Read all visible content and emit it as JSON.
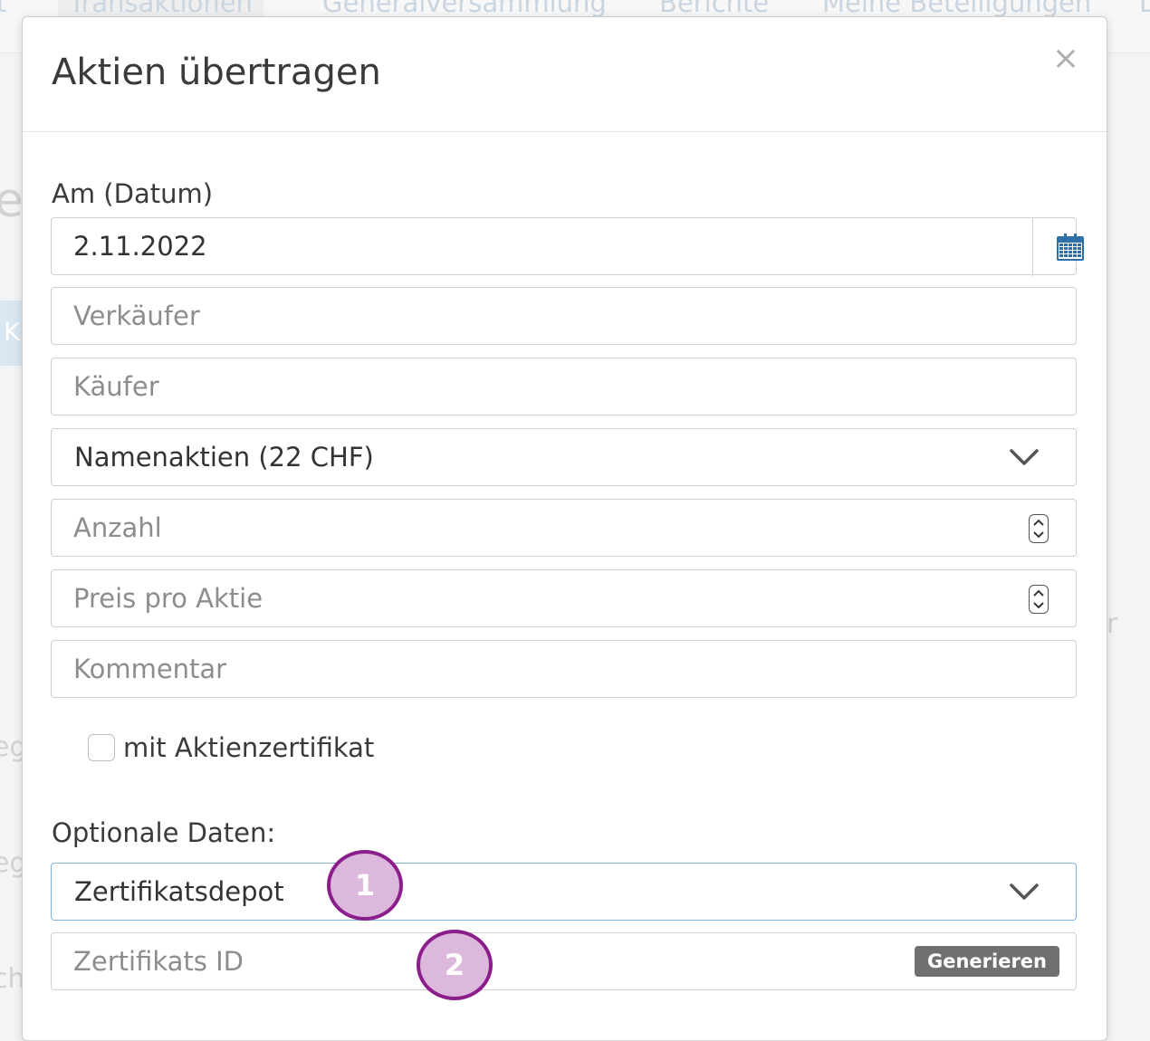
{
  "background": {
    "nav_tabs": [
      "t",
      "Transaktionen",
      "Generalversammlung",
      "Berichte",
      "Meine Beteiligungen",
      "L"
    ],
    "side_fragments": [
      "e",
      "K",
      "eg",
      "eg",
      "ch",
      "r"
    ]
  },
  "modal": {
    "title": "Aktien übertragen",
    "close": "×",
    "date_label": "Am (Datum)",
    "date_value": "2.11.2022",
    "seller_placeholder": "Verkäufer",
    "buyer_placeholder": "Käufer",
    "share_type_value": "Namenaktien (22 CHF)",
    "quantity_placeholder": "Anzahl",
    "price_placeholder": "Preis pro Aktie",
    "comment_placeholder": "Kommentar",
    "certificate_checkbox_label": "mit Aktienzertifikat",
    "optional_label": "Optionale Daten:",
    "depot_value": "Zertifikatsdepot",
    "certificate_id_placeholder": "Zertifikats ID",
    "generate_button": "Generieren"
  },
  "annotations": [
    "1",
    "2"
  ],
  "colors": {
    "calendar_icon": "#2f6fa8",
    "marker_fill": "#dcb8dc",
    "marker_border": "#8b1e8b",
    "focus_border": "#7fb2dd"
  }
}
